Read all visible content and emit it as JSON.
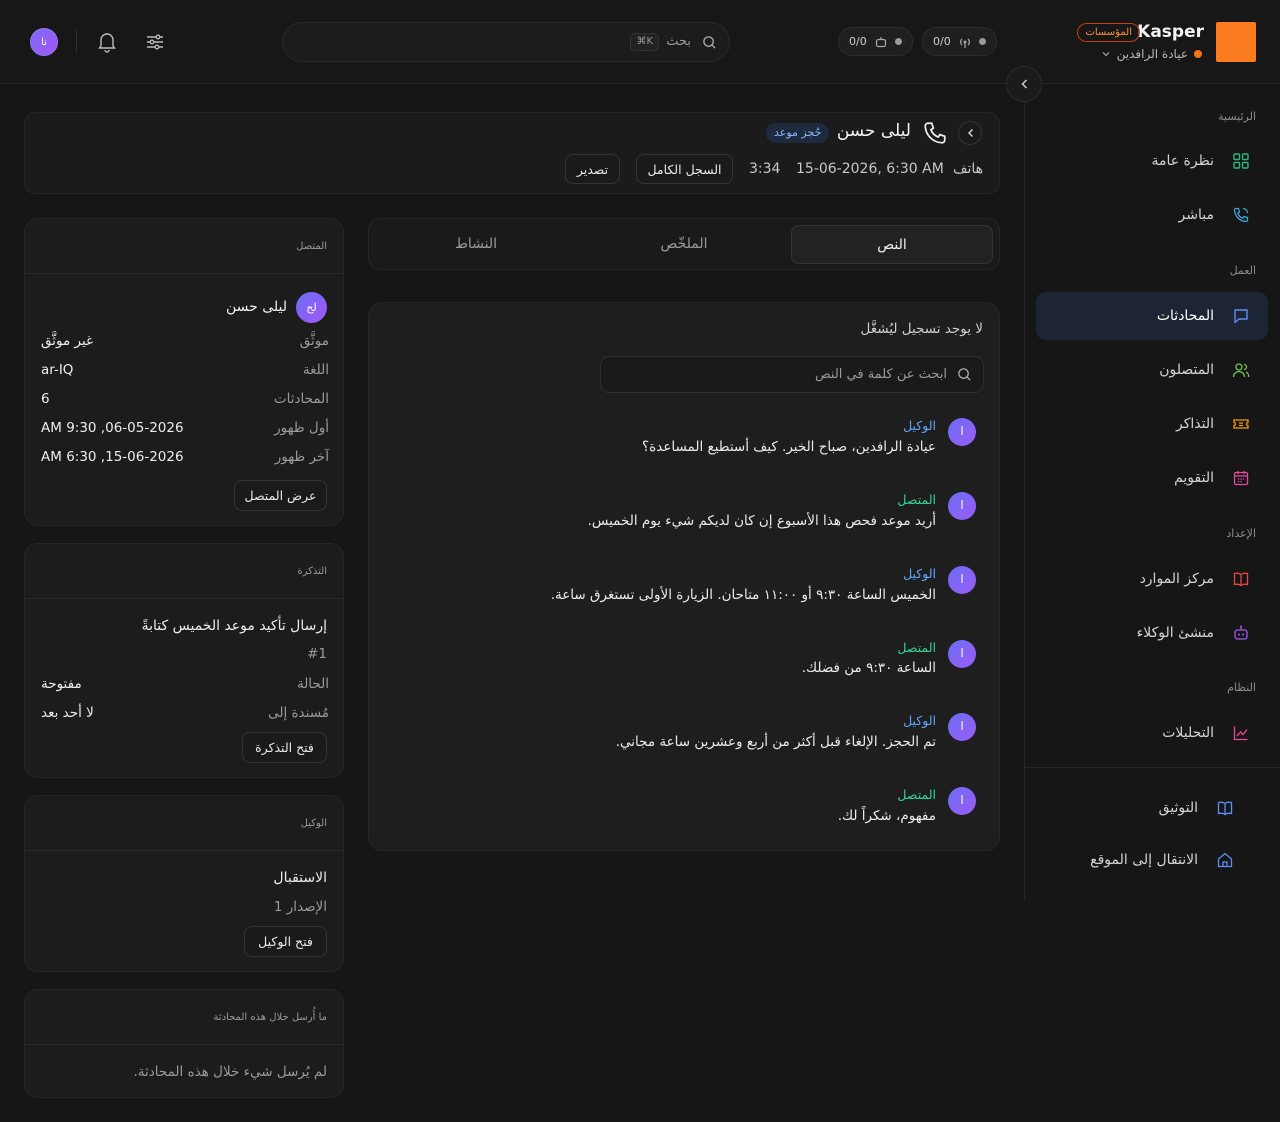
{
  "brand": {
    "name": "Kasper",
    "badge": "المؤسسات",
    "org": "عيادة الرافدين",
    "logo_color": "#fa7c1e"
  },
  "topbar": {
    "pill_calls": "0/0",
    "pill_bots": "0/0",
    "search_placeholder": "بحث",
    "search_shortcut": "⌘K",
    "user_initials": "نا"
  },
  "sidebar": {
    "sections": {
      "home": "الرئيسية",
      "work": "العمل",
      "setup": "الإعداد",
      "system": "النظام"
    },
    "items": [
      {
        "label": "نظرة عامة",
        "icon": "grid-icon"
      },
      {
        "label": "مباشر",
        "icon": "phone-live-icon"
      },
      {
        "label": "المحادثات",
        "icon": "chat-icon",
        "active": true
      },
      {
        "label": "المتصلون",
        "icon": "users-icon"
      },
      {
        "label": "التذاكر",
        "icon": "ticket-icon"
      },
      {
        "label": "التقويم",
        "icon": "calendar-icon"
      },
      {
        "label": "مركز الموارد",
        "icon": "book-icon"
      },
      {
        "label": "منشئ الوكلاء",
        "icon": "bot-icon"
      },
      {
        "label": "التحليلات",
        "icon": "chart-icon"
      }
    ],
    "footer": [
      {
        "label": "التوثيق",
        "icon": "docs-icon"
      },
      {
        "label": "الانتقال إلى الموقع",
        "icon": "home-icon"
      }
    ]
  },
  "header": {
    "caller_name": "ليلى حسن",
    "tag": "حُجز موعد",
    "channel": "هاتف",
    "datetime": "15-06-2026, 6:30 AM",
    "duration": "3:34",
    "full_log_button": "السجل الكامل",
    "export_button": "تصدير"
  },
  "tabs": [
    "النص",
    "الملخّص",
    "النشاط"
  ],
  "transcript": {
    "no_recording": "لا يوجد تسجيل ليُشغَّل",
    "search_placeholder": "ابحث عن كلمة في النص",
    "messages": [
      {
        "role": "الوكيل",
        "type": "agent",
        "avatar": "ا",
        "text": "عيادة الرافدين، صباح الخير. كيف أستطيع المساعدة؟"
      },
      {
        "role": "المتصل",
        "type": "caller",
        "avatar": "ا",
        "text": "أريد موعد فحص هذا الأسبوع إن كان لديكم شيء يوم الخميس."
      },
      {
        "role": "الوكيل",
        "type": "agent",
        "avatar": "ا",
        "text": "الخميس الساعة ٩:٣٠ أو ١١:٠٠ متاحان. الزيارة الأولى تستغرق ساعة."
      },
      {
        "role": "المتصل",
        "type": "caller",
        "avatar": "ا",
        "text": "الساعة ٩:٣٠ من فضلك."
      },
      {
        "role": "الوكيل",
        "type": "agent",
        "avatar": "ا",
        "text": "تم الحجز. الإلغاء قبل أكثر من أربع وعشرين ساعة مجاني."
      },
      {
        "role": "المتصل",
        "type": "caller",
        "avatar": "ا",
        "text": "مفهوم، شكراً لك."
      }
    ]
  },
  "caller_card": {
    "heading": "المتصل",
    "initials": "لح",
    "name": "ليلى حسن",
    "rows": [
      {
        "k": "موثَّق",
        "v": "غير موثَّق"
      },
      {
        "k": "اللغة",
        "v": "ar-IQ"
      },
      {
        "k": "المحادثات",
        "v": "6"
      },
      {
        "k": "أول ظهور",
        "v": "06-05-2026, 9:30 AM"
      },
      {
        "k": "آخر ظهور",
        "v": "15-06-2026, 6:30 AM"
      }
    ],
    "button": "عرض المتصل"
  },
  "ticket_card": {
    "heading": "التذكرة",
    "title": "إرسال تأكيد موعد الخميس كتابةً",
    "number": "#1",
    "status_k": "الحالة",
    "status_v": "مفتوحة",
    "assign_k": "مُسندة إلى",
    "assign_v": "لا أحد بعد",
    "button": "فتح التذكرة"
  },
  "agent_card": {
    "heading": "الوكيل",
    "name": "الاستقبال",
    "version": "الإصدار 1",
    "button": "فتح الوكيل"
  },
  "sent_card": {
    "heading": "ما أُرسل خلال هذه المحادثة",
    "empty": "لم يُرسل شيء خلال هذه المحادثة."
  }
}
